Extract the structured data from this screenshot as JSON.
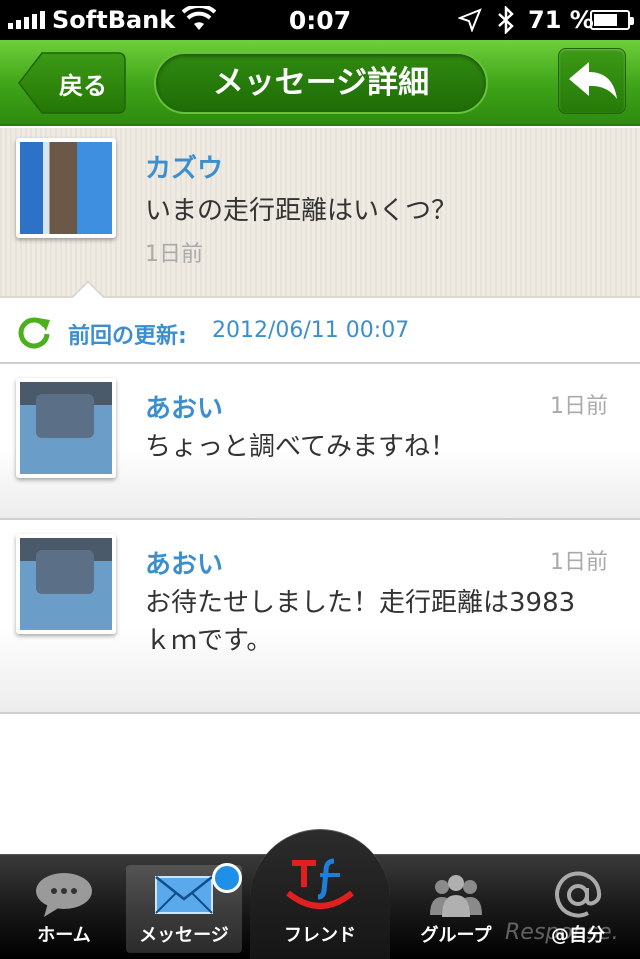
{
  "status_bar": {
    "carrier": "SoftBank",
    "time": "0:07",
    "battery_percent": "71 %",
    "battery_level": 0.71,
    "icons": [
      "signal-icon",
      "wifi-icon",
      "location-arrow-icon",
      "bluetooth-icon",
      "battery-icon"
    ]
  },
  "nav": {
    "back_label": "戻る",
    "title": "メッセージ詳細",
    "reply_icon": "reply-arrow-icon"
  },
  "original_message": {
    "name": "カズウ",
    "text": "いまの走行距離はいくつ？",
    "time": "1日前"
  },
  "last_update": {
    "label": "前回の更新:",
    "value": "2012/06/11 00:07",
    "icon": "refresh-icon"
  },
  "replies": [
    {
      "name": "あおい",
      "time": "1日前",
      "text": "ちょっと調べてみますね！"
    },
    {
      "name": "あおい",
      "time": "1日前",
      "text": "お待たせしました！走行距離は3983ｋｍです。"
    }
  ],
  "tabs": [
    {
      "label": "ホーム",
      "icon": "speech-bubble-icon"
    },
    {
      "label": "メッセージ",
      "icon": "envelope-icon",
      "selected": true,
      "badge_color": "#1e90e8"
    },
    {
      "label": "フレンド",
      "icon": "tf-smile-logo-icon"
    },
    {
      "label": "グループ",
      "icon": "people-icon"
    },
    {
      "label": "@自分",
      "icon": "at-sign-icon"
    }
  ],
  "watermark": "Response.",
  "colors": {
    "nav_green": "#3ea318",
    "name_blue": "#3c8fcf",
    "badge_blue": "#1e90e8",
    "logo_red": "#e02020"
  }
}
